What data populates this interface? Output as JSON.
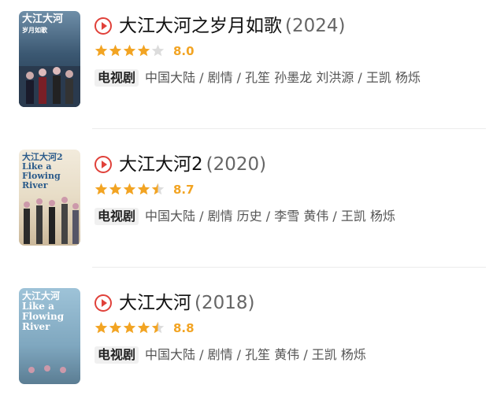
{
  "colors": {
    "accent_red": "#e0413a",
    "star_gold": "#f2a423",
    "star_empty": "#dcdcdc",
    "text_dark": "#111111",
    "text_meta": "#555555"
  },
  "items": [
    {
      "poster_icon": "tv-poster-image",
      "title": "大江大河之岁月如歌",
      "year": "(2024)",
      "stars": 4.0,
      "rating": "8.0",
      "type": "电视剧",
      "meta": "中国大陆 / 剧情 / 孔笙 孙墨龙 刘洪源 / 王凯 杨烁"
    },
    {
      "poster_icon": "tv-poster-image",
      "title": "大江大河2",
      "year": "(2020)",
      "stars": 4.5,
      "rating": "8.7",
      "type": "电视剧",
      "meta": "中国大陆 / 剧情 历史 / 李雪 黄伟 / 王凯 杨烁"
    },
    {
      "poster_icon": "tv-poster-image",
      "title": "大江大河",
      "year": "(2018)",
      "stars": 4.5,
      "rating": "8.8",
      "type": "电视剧",
      "meta": "中国大陆 / 剧情 / 孔笙 黄伟 / 王凯 杨烁"
    }
  ]
}
